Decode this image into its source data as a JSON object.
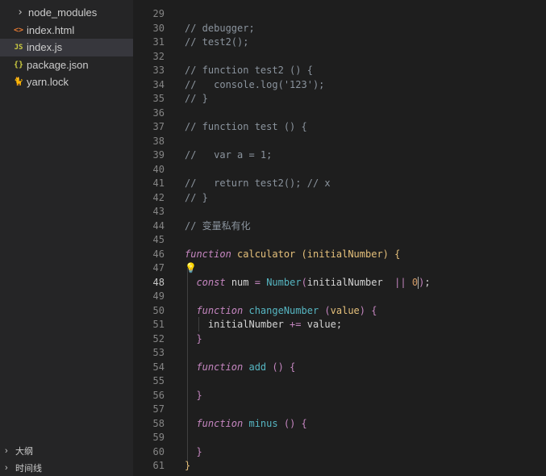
{
  "explorer": {
    "items": [
      {
        "icon": "chevron-right-icon",
        "glyph": "›",
        "label": "node_modules",
        "kind": "folder"
      },
      {
        "icon": "html-file-icon",
        "glyph": "<>",
        "label": "index.html",
        "kind": "html"
      },
      {
        "icon": "js-file-icon",
        "glyph": "JS",
        "label": "index.js",
        "kind": "js",
        "active": true
      },
      {
        "icon": "json-file-icon",
        "glyph": "{}",
        "label": "package.json",
        "kind": "json"
      },
      {
        "icon": "yarn-file-icon",
        "glyph": "🐈",
        "label": "yarn.lock",
        "kind": "yarn"
      }
    ]
  },
  "panels": {
    "outline": "大纲",
    "timeline": "时间线"
  },
  "editor": {
    "current_line": 48,
    "lines": [
      {
        "n": "29",
        "tokens": []
      },
      {
        "n": "30",
        "tokens": [
          [
            "t-comment",
            "// debugger;"
          ]
        ]
      },
      {
        "n": "31",
        "tokens": [
          [
            "t-comment",
            "// test2();"
          ]
        ]
      },
      {
        "n": "32",
        "tokens": []
      },
      {
        "n": "33",
        "tokens": [
          [
            "t-comment",
            "// function test2 () {"
          ]
        ]
      },
      {
        "n": "34",
        "tokens": [
          [
            "t-comment",
            "//   console.log('123');"
          ]
        ]
      },
      {
        "n": "35",
        "tokens": [
          [
            "t-comment",
            "// }"
          ]
        ]
      },
      {
        "n": "36",
        "tokens": []
      },
      {
        "n": "37",
        "tokens": [
          [
            "t-comment",
            "// function test () {"
          ]
        ]
      },
      {
        "n": "38",
        "tokens": []
      },
      {
        "n": "39",
        "tokens": [
          [
            "t-comment",
            "//   var a = 1;"
          ]
        ]
      },
      {
        "n": "40",
        "tokens": []
      },
      {
        "n": "41",
        "tokens": [
          [
            "t-comment",
            "//   return test2(); // x"
          ]
        ]
      },
      {
        "n": "42",
        "tokens": [
          [
            "t-comment",
            "// }"
          ]
        ]
      },
      {
        "n": "43",
        "tokens": []
      },
      {
        "n": "44",
        "tokens": [
          [
            "t-comment",
            "// 变量私有化"
          ]
        ]
      },
      {
        "n": "45",
        "tokens": []
      },
      {
        "n": "46",
        "tokens": [
          [
            "t-keyword",
            "function"
          ],
          [
            "t-plain",
            " "
          ],
          [
            "t-fn-decl",
            "calculator"
          ],
          [
            "t-plain",
            " "
          ],
          [
            "t-brace",
            "("
          ],
          [
            "t-param",
            "initialNumber"
          ],
          [
            "t-brace",
            ")"
          ],
          [
            "t-plain",
            " "
          ],
          [
            "t-brace",
            "{"
          ]
        ]
      },
      {
        "n": "47",
        "tokens": []
      },
      {
        "n": "48",
        "tokens": [
          [
            "t-plain",
            "  "
          ],
          [
            "t-keyword",
            "const"
          ],
          [
            "t-plain",
            " "
          ],
          [
            "t-var",
            "num"
          ],
          [
            "t-plain",
            " "
          ],
          [
            "t-op",
            "="
          ],
          [
            "t-plain",
            " "
          ],
          [
            "t-class",
            "Number"
          ],
          [
            "t-brace2",
            "("
          ],
          [
            "t-plain",
            "initialNumber"
          ],
          [
            "t-plain",
            "  "
          ],
          [
            "t-op",
            "||"
          ],
          [
            "t-plain",
            " "
          ],
          [
            "t-num",
            "0"
          ],
          [
            "cursor",
            ""
          ],
          [
            "t-brace2",
            ")"
          ],
          [
            "t-plain",
            ";"
          ]
        ]
      },
      {
        "n": "49",
        "tokens": []
      },
      {
        "n": "50",
        "tokens": [
          [
            "t-plain",
            "  "
          ],
          [
            "t-keyword",
            "function"
          ],
          [
            "t-plain",
            " "
          ],
          [
            "t-fn",
            "changeNumber"
          ],
          [
            "t-plain",
            " "
          ],
          [
            "t-brace2",
            "("
          ],
          [
            "t-param",
            "value"
          ],
          [
            "t-brace2",
            ")"
          ],
          [
            "t-plain",
            " "
          ],
          [
            "t-brace2",
            "{"
          ]
        ]
      },
      {
        "n": "51",
        "tokens": [
          [
            "t-plain",
            "    initialNumber "
          ],
          [
            "t-op",
            "+="
          ],
          [
            "t-plain",
            " value;"
          ]
        ]
      },
      {
        "n": "52",
        "tokens": [
          [
            "t-plain",
            "  "
          ],
          [
            "t-brace2",
            "}"
          ]
        ]
      },
      {
        "n": "53",
        "tokens": []
      },
      {
        "n": "54",
        "tokens": [
          [
            "t-plain",
            "  "
          ],
          [
            "t-keyword",
            "function"
          ],
          [
            "t-plain",
            " "
          ],
          [
            "t-fn",
            "add"
          ],
          [
            "t-plain",
            " "
          ],
          [
            "t-brace2",
            "()"
          ],
          [
            "t-plain",
            " "
          ],
          [
            "t-brace2",
            "{"
          ]
        ]
      },
      {
        "n": "55",
        "tokens": []
      },
      {
        "n": "56",
        "tokens": [
          [
            "t-plain",
            "  "
          ],
          [
            "t-brace2",
            "}"
          ]
        ]
      },
      {
        "n": "57",
        "tokens": []
      },
      {
        "n": "58",
        "tokens": [
          [
            "t-plain",
            "  "
          ],
          [
            "t-keyword",
            "function"
          ],
          [
            "t-plain",
            " "
          ],
          [
            "t-fn",
            "minus"
          ],
          [
            "t-plain",
            " "
          ],
          [
            "t-brace2",
            "()"
          ],
          [
            "t-plain",
            " "
          ],
          [
            "t-brace2",
            "{"
          ]
        ]
      },
      {
        "n": "59",
        "tokens": []
      },
      {
        "n": "60",
        "tokens": [
          [
            "t-plain",
            "  "
          ],
          [
            "t-brace2",
            "}"
          ]
        ]
      },
      {
        "n": "61",
        "tokens": [
          [
            "t-brace",
            "}"
          ]
        ]
      }
    ]
  },
  "colors": {
    "sidebar_bg": "#252526",
    "editor_bg": "#1e1e1e",
    "active_row_bg": "#37373d",
    "lightbulb": "#ffcc00"
  }
}
